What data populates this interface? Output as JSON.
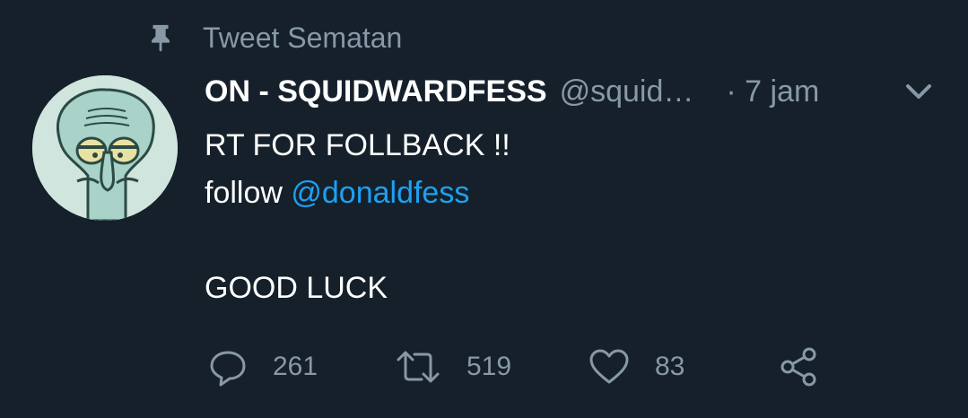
{
  "pinned": {
    "label": "Tweet Sematan",
    "icon": "pin-icon"
  },
  "tweet": {
    "author": {
      "display_name": "ON - SQUIDWARDFESS",
      "handle": "@squid…",
      "avatar": "squidward-avatar"
    },
    "time": "· 7 jam",
    "menu_icon": "chevron-down-icon",
    "body": {
      "line1": "RT FOR FOLLBACK !!",
      "line2_prefix": "follow ",
      "line2_mention": "@donaldfess",
      "line4": "GOOD LUCK"
    },
    "actions": {
      "reply": {
        "icon": "reply-icon",
        "count": "261"
      },
      "retweet": {
        "icon": "retweet-icon",
        "count": "519"
      },
      "like": {
        "icon": "heart-icon",
        "count": "83"
      },
      "share": {
        "icon": "share-icon"
      }
    }
  },
  "colors": {
    "background": "#15202b",
    "secondary_text": "#8899a6",
    "link": "#1da1f2",
    "primary_text": "#ffffff"
  }
}
